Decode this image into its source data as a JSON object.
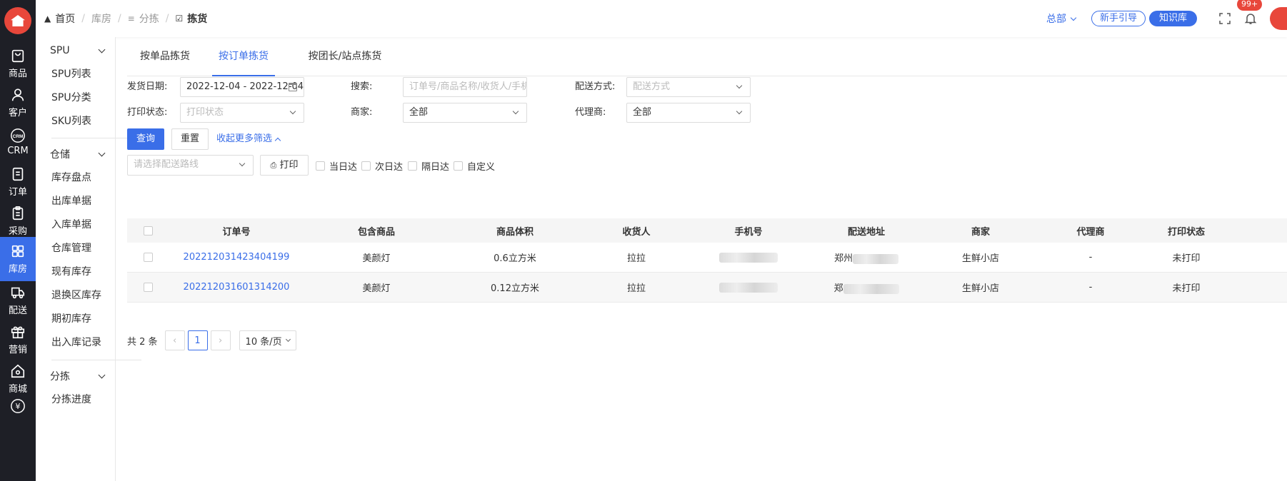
{
  "rail": {
    "items": [
      {
        "label": "商品",
        "icon": "bag-icon"
      },
      {
        "label": "客户",
        "icon": "user-icon"
      },
      {
        "label": "CRM",
        "icon": "crm-icon",
        "icon_text": "CRM"
      },
      {
        "label": "订单",
        "icon": "document-icon"
      },
      {
        "label": "采购",
        "icon": "clipboard-icon"
      },
      {
        "label": "库房",
        "icon": "grid-icon"
      },
      {
        "label": "配送",
        "icon": "truck-icon"
      },
      {
        "label": "营销",
        "icon": "gift-icon"
      },
      {
        "label": "商城",
        "icon": "home-icon"
      },
      {
        "label": "",
        "icon": "yen-icon",
        "icon_text": "¥"
      }
    ],
    "active_index": 5
  },
  "submenu": {
    "groups": [
      {
        "label": "SPU",
        "items": [
          "SPU列表",
          "SPU分类",
          "SKU列表"
        ]
      },
      {
        "label": "仓储",
        "items": [
          "库存盘点",
          "出库单据",
          "入库单据",
          "仓库管理",
          "现有库存",
          "退换区库存",
          "期初库存",
          "出入库记录"
        ]
      },
      {
        "label": "分拣",
        "items": [
          "分拣进度"
        ]
      }
    ]
  },
  "topbar": {
    "breadcrumb": [
      "首页",
      "库房",
      "分拣",
      "拣货"
    ],
    "hq_label": "总部",
    "guide_label": "新手引导",
    "kb_label": "知识库",
    "badge": "99+"
  },
  "tabs": [
    "按单品拣货",
    "按订单拣货",
    "按团长/站点拣货"
  ],
  "active_tab": 1,
  "filters": {
    "ship_date_label": "发货日期:",
    "ship_date_value": "2022-12-04 - 2022-12-04",
    "search_label": "搜索:",
    "search_placeholder": "订单号/商品名称/收货人/手机号",
    "delivery_label": "配送方式:",
    "delivery_placeholder": "配送方式",
    "print_status_label": "打印状态:",
    "print_status_placeholder": "打印状态",
    "merchant_label": "商家:",
    "merchant_value": "全部",
    "agent_label": "代理商:",
    "agent_value": "全部"
  },
  "actions": {
    "query": "查询",
    "reset": "重置",
    "collapse": "收起更多筛选",
    "route_placeholder": "请选择配送路线",
    "print": "打印",
    "checks": [
      "当日达",
      "次日达",
      "隔日达",
      "自定义"
    ]
  },
  "table": {
    "columns": [
      "订单号",
      "包含商品",
      "商品体积",
      "收货人",
      "手机号",
      "配送地址",
      "商家",
      "代理商",
      "打印状态"
    ],
    "rows": [
      {
        "order": "202212031423404199",
        "goods": "美颜灯",
        "volume": "0.6立方米",
        "receiver": "拉拉",
        "phone": "",
        "address": "郑州",
        "merchant": "生鲜小店",
        "agent": "-",
        "status": "未打印"
      },
      {
        "order": "202212031601314200",
        "goods": "美颜灯",
        "volume": "0.12立方米",
        "receiver": "拉拉",
        "phone": "",
        "address": "郑",
        "merchant": "生鲜小店",
        "agent": "-",
        "status": "未打印"
      }
    ]
  },
  "pager": {
    "total": "共 2 条",
    "current": "1",
    "page_size": "10 条/页"
  },
  "colors": {
    "primary": "#3a6ee8",
    "rail_bg": "#1e1f26",
    "badge": "#e8473b"
  }
}
